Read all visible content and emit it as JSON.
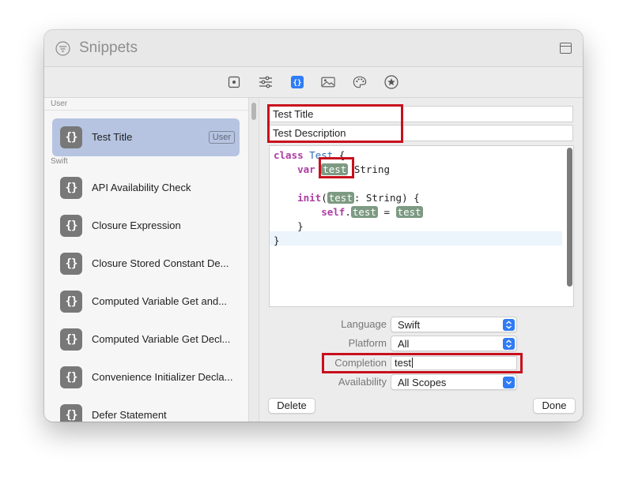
{
  "window": {
    "title": "Snippets"
  },
  "toolbar": {
    "buttons": [
      {
        "icon": "stop-icon",
        "label": "stop"
      },
      {
        "icon": "sliders-icon",
        "label": "attributes"
      },
      {
        "icon": "braces-icon",
        "label": "snippets",
        "selected": true
      },
      {
        "icon": "photo-icon",
        "label": "media"
      },
      {
        "icon": "palette-icon",
        "label": "colors"
      },
      {
        "icon": "star-icon",
        "label": "symbols"
      }
    ]
  },
  "sidebar": {
    "sections": [
      {
        "header": "User",
        "items": [
          {
            "label": "Test Title",
            "badge": "User",
            "selected": true
          }
        ]
      },
      {
        "header": "Swift",
        "items": [
          {
            "label": "API Availability Check"
          },
          {
            "label": "Closure Expression"
          },
          {
            "label": "Closure Stored Constant De..."
          },
          {
            "label": "Computed Variable Get and..."
          },
          {
            "label": "Computed Variable Get Decl..."
          },
          {
            "label": "Convenience Initializer Decla..."
          },
          {
            "label": "Defer Statement"
          }
        ]
      }
    ],
    "icon_glyph": "{}"
  },
  "detail": {
    "title": "Test Title",
    "description": "Test Description",
    "code": {
      "class_kw": "class",
      "class_name": "Test",
      "open": " {",
      "var_kw": "var",
      "token": "test",
      "type_annot": " String",
      "init_kw": "init",
      "param_rest": ": String) {",
      "self_kw": "self",
      "assign": " = ",
      "close_inner": "}",
      "close_outer": "}"
    },
    "form": {
      "language_label": "Language",
      "language_value": "Swift",
      "platform_label": "Platform",
      "platform_value": "All",
      "completion_label": "Completion",
      "completion_value": "test",
      "availability_label": "Availability",
      "availability_value": "All Scopes"
    },
    "buttons": {
      "delete": "Delete",
      "done": "Done"
    }
  },
  "colors": {
    "accent": "#2f7cf6",
    "selection": "#b6c4e2",
    "annotation": "#c8101d",
    "token_bg": "#7d9a82",
    "keyword": "#ad3da4",
    "type": "#2e6fbb"
  }
}
